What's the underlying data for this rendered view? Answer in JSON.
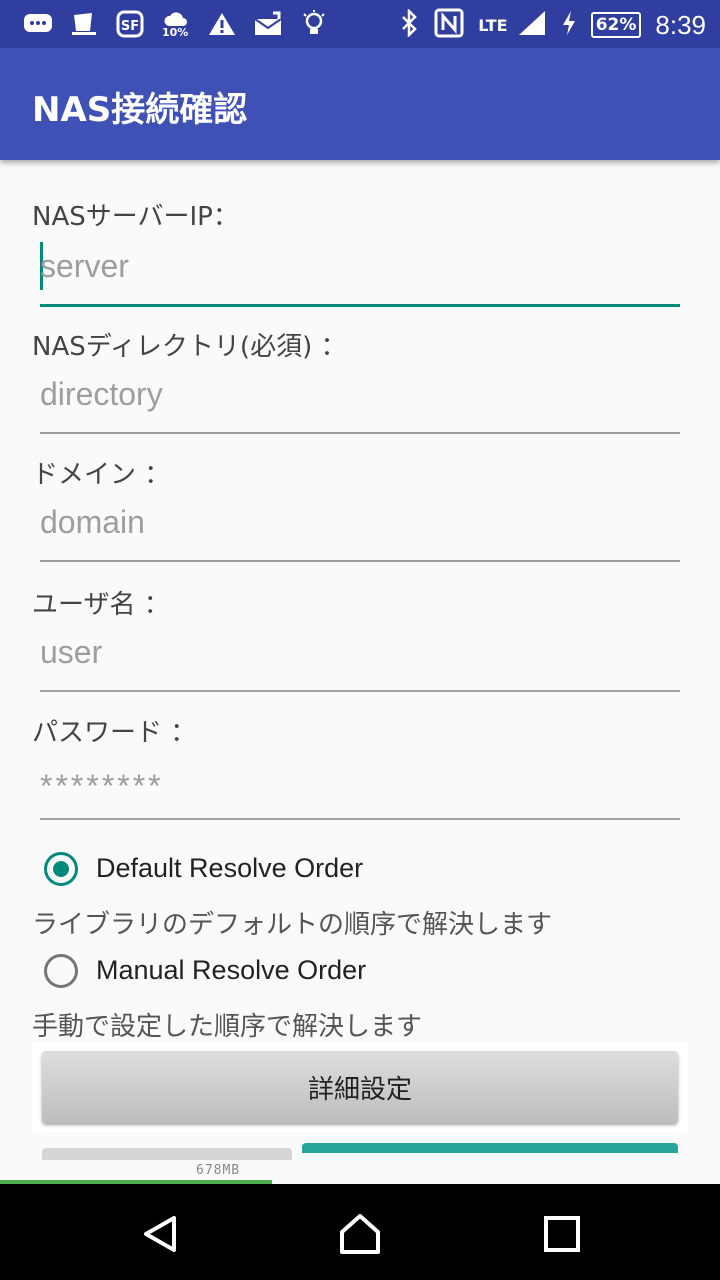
{
  "status_bar": {
    "time": "8:39",
    "battery": "62%",
    "network": "LTE",
    "weather_percent": "10%",
    "left_icons": [
      "chat-icon",
      "cup-icon",
      "sf-icon",
      "weather-icon",
      "warning-icon",
      "mail-icon",
      "bulb-icon"
    ]
  },
  "app_bar": {
    "title": "NAS接続確認"
  },
  "form": {
    "server": {
      "label": "NASサーバーIP：",
      "placeholder": "server"
    },
    "directory": {
      "label": "NASディレクトリ(必須) ：",
      "placeholder": "directory"
    },
    "domain": {
      "label": "ドメイン ：",
      "placeholder": "domain"
    },
    "user": {
      "label": "ユーザ名 ：",
      "placeholder": "user"
    },
    "password": {
      "label": "パスワード ：",
      "placeholder": "********"
    }
  },
  "resolve": {
    "default": {
      "label": "Default Resolve Order",
      "description": "ライブラリのデフォルトの順序で解決します",
      "selected": true
    },
    "manual": {
      "label": "Manual Resolve Order",
      "description": "手動で設定した順序で解決します",
      "selected": false
    }
  },
  "buttons": {
    "advanced": "詳細設定"
  },
  "memory": {
    "label": "678MB"
  },
  "colors": {
    "primary": "#3f51b5",
    "primary_dark": "#303f9f",
    "accent": "#00897b"
  }
}
